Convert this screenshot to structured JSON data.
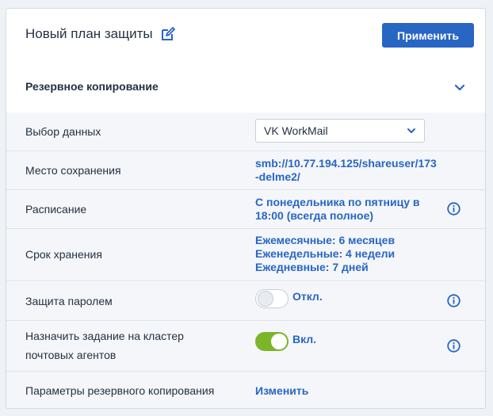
{
  "header": {
    "plan_title": "Новый план защиты",
    "apply_label": "Применить"
  },
  "section": {
    "title": "Резервное копирование"
  },
  "rows": {
    "data_selection": {
      "label": "Выбор данных",
      "selected": "VK WorkMail"
    },
    "location": {
      "label": "Место сохранения",
      "value": "smb://10.77.194.125/shareuser/173-delme2/"
    },
    "schedule": {
      "label": "Расписание",
      "value": "С понедельника по пятницу в 18:00 (всегда полное)"
    },
    "retention": {
      "label": "Срок хранения",
      "lines": [
        "Ежемесячные: 6 месяцев",
        "Еженедельные: 4 недели",
        "Ежедневные: 7 дней"
      ]
    },
    "password": {
      "label": "Защита паролем",
      "state": "Откл.",
      "enabled": false
    },
    "cluster": {
      "label_lines": [
        "Назначить задание на кластер",
        "почтовых агентов"
      ],
      "state": "Вкл.",
      "enabled": true
    },
    "backup_params": {
      "label": "Параметры резервного копирования",
      "value": "Изменить"
    }
  },
  "colors": {
    "accent": "#2866c4",
    "toggle_on": "#7cb52a",
    "row_bg": "#f4f6f9"
  },
  "icons": [
    "edit-icon",
    "chevron-down-icon",
    "info-icon"
  ]
}
